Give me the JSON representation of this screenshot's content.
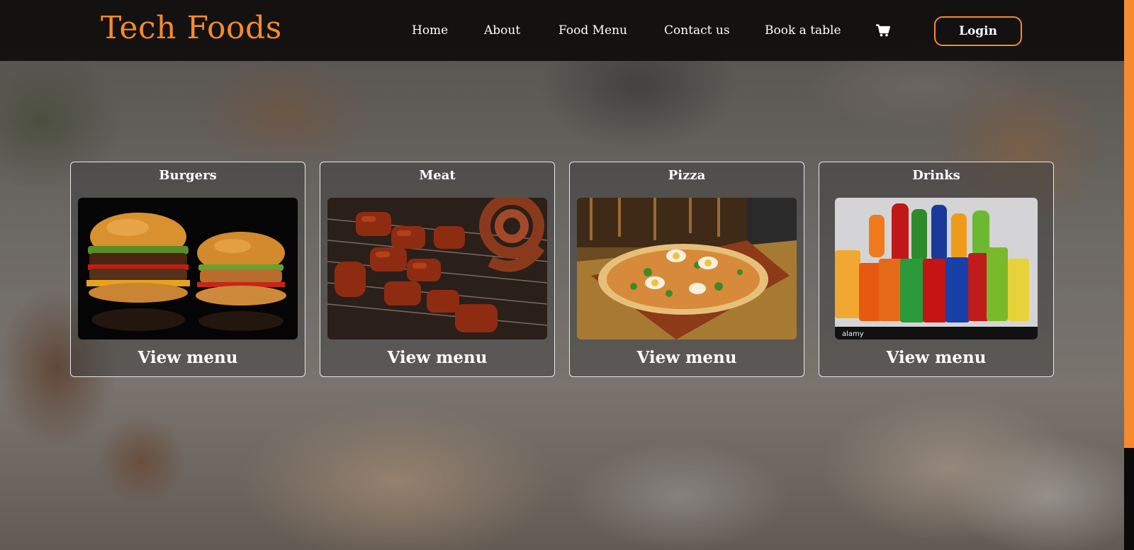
{
  "brand": {
    "name": "Tech Foods",
    "color": "#f58a2f"
  },
  "nav": {
    "items": [
      {
        "label": "Home"
      },
      {
        "label": "About"
      },
      {
        "label": "Food Menu"
      },
      {
        "label": "Contact us"
      },
      {
        "label": "Book a table"
      }
    ],
    "cart_icon": "shopping-cart-icon",
    "login_label": "Login"
  },
  "categories": [
    {
      "title": "Burgers",
      "action": "View menu",
      "image": "burgers-photo"
    },
    {
      "title": "Meat",
      "action": "View menu",
      "image": "grilled-meat-photo"
    },
    {
      "title": "Pizza",
      "action": "View menu",
      "image": "pizza-photo"
    },
    {
      "title": "Drinks",
      "action": "View menu",
      "image": "soft-drinks-photo",
      "watermark": "alamy"
    }
  ],
  "colors": {
    "accent": "#f58a2f",
    "nav_bg": "#0e0d0c",
    "text": "#ffffff"
  }
}
